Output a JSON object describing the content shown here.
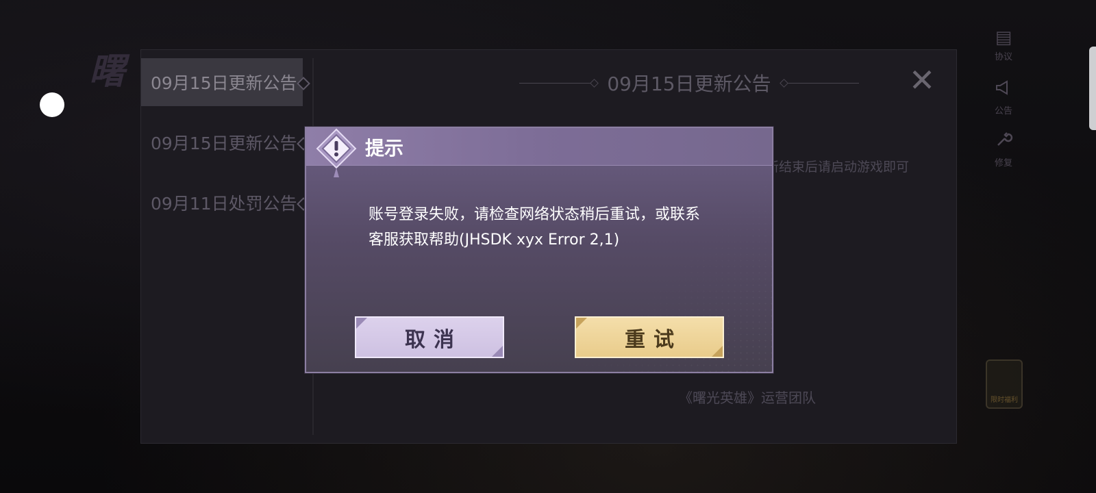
{
  "background": {
    "logo_glyph": "曙",
    "side_tools": [
      {
        "icon": "document-icon",
        "glyph": "▤",
        "label": "协议"
      },
      {
        "icon": "megaphone-icon",
        "glyph": "📢",
        "label": "公告"
      },
      {
        "icon": "wrench-icon",
        "glyph": "🔧",
        "label": "修复"
      }
    ],
    "badge_label": "限时福利"
  },
  "notice": {
    "tabs": [
      {
        "label": "09月15日更新公告",
        "active": true
      },
      {
        "label": "09月15日更新公告",
        "active": false
      },
      {
        "label": "09月11日处罚公告",
        "active": false
      }
    ],
    "title": "09月15日更新公告",
    "close_glyph": "✕",
    "body_fragment": "新结束后请启动游戏即可",
    "signature": "《曙光英雄》运营团队"
  },
  "dialog": {
    "title": "提示",
    "message_line1": "账号登录失败，请检查网络状态稍后重试，或联系",
    "message_line2": "客服获取帮助(JHSDK xyx Error 2,1)",
    "cancel_label": "取消",
    "retry_label": "重试"
  },
  "colors": {
    "dialog_header": "#8f7ea8",
    "cancel_button": "#d6cae8",
    "retry_button": "#efd59a"
  }
}
